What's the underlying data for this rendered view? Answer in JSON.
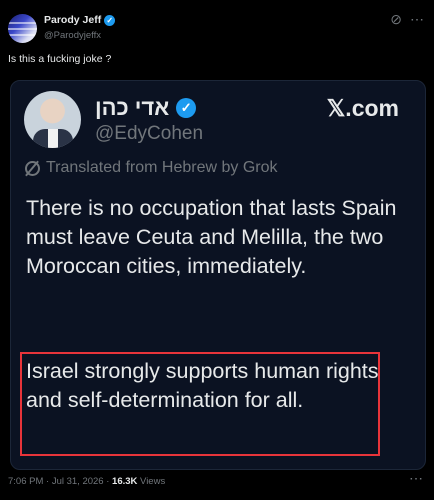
{
  "post": {
    "author": {
      "name": "Parody Jeff",
      "handle": "@Parodyjeffx"
    },
    "text": "Is this a fucking joke ?",
    "timestamp": "7:06 PM · Jul 31, 2026 · ",
    "views_count": "16.3K",
    "views_label": " Views"
  },
  "embedded_tweet": {
    "name": "אדי כהן",
    "handle": "@EdyCohen",
    "brand": "𝕏.com",
    "translated_label": "Translated from Hebrew by Grok",
    "body": "There is no occupation that lasts Spain must leave Ceuta and Melilla, the two Moroccan cities, immediately.",
    "highlighted_text": "Israel strongly supports human rights and self-determination for all."
  },
  "colors": {
    "background": "#000000",
    "verified_blue": "#1d9bf0",
    "highlight_red": "#e8343a"
  }
}
